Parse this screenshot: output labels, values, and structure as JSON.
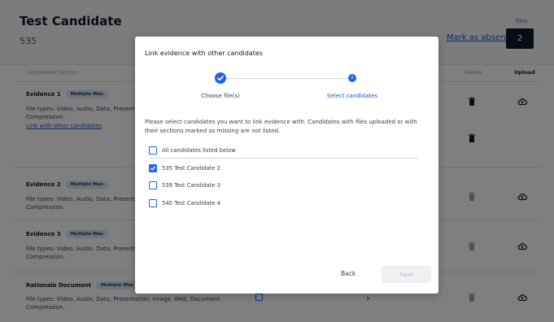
{
  "candidate": {
    "title": "Test Candidate",
    "number": "535",
    "mark_absent_label": "Mark as absent",
    "files_label": "Files",
    "files_count": "2"
  },
  "table": {
    "columns": {
      "component_section": "Component Section",
      "delete": "Delete",
      "upload": "Upload"
    }
  },
  "sections": [
    {
      "name": "Evidence 1",
      "badge": "Multiple files",
      "desc_line1": "File types: Video, Audio, Data, Presenta",
      "desc_line2": "Compression.",
      "link": "Link with other candidates"
    },
    {
      "name": "Evidence 2",
      "badge": "Multiple files",
      "desc_line1": "File types: Video, Audio, Data, Presenta",
      "desc_line2": "Compression."
    },
    {
      "name": "Evidence 3",
      "badge": "Multiple files",
      "desc_line1": "File types: Video, Audio, Data, Presenta",
      "desc_line2": "Compression."
    },
    {
      "name": "Rationale Document",
      "badge": "Multiple files",
      "desc_line1": "File types: Video, Audio, Data, Presentation, Image, Web, Document,",
      "desc_line2": "Compression."
    }
  ],
  "icons": {
    "delete": "trash-icon",
    "upload": "cloud-upload-icon",
    "step_done": "check-icon"
  },
  "modal": {
    "title": "Link evidence with other candidates",
    "steps": [
      {
        "label": "Choose file(s)",
        "status": "done"
      },
      {
        "label": "Select candidates",
        "status": "current",
        "number": "2"
      }
    ],
    "instructions": "Please select candidates you want to link evidence with. Candidates with files uploaded or with their sections marked as missing are not listed.",
    "select_all_label": "All candidates listed below",
    "candidates": [
      {
        "label": "535 Test Candidate 2",
        "checked": true
      },
      {
        "label": "539 Test Candidate 3",
        "checked": false
      },
      {
        "label": "540 Test Candidate 4",
        "checked": false
      }
    ],
    "back_label": "Back",
    "save_label": "Save"
  },
  "colors": {
    "accent": "#2563eb",
    "link": "#1d4ed8",
    "badge_bg": "#dbe7f5",
    "overlay": "rgba(0,0,0,0.5)"
  }
}
